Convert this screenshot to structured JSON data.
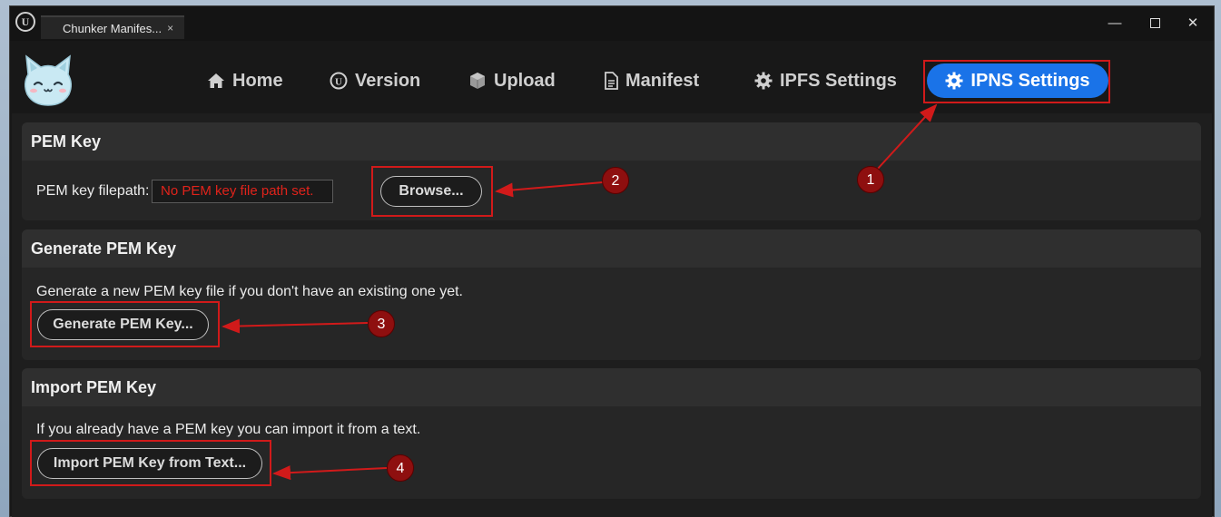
{
  "window": {
    "tab_title": "Chunker Manifes...",
    "tab_close": "×",
    "minimize": "—",
    "close": "✕"
  },
  "nav": {
    "items": [
      {
        "label": "Home",
        "icon": "home-icon"
      },
      {
        "label": "Version",
        "icon": "unreal-logo-icon"
      },
      {
        "label": "Upload",
        "icon": "cube-icon"
      },
      {
        "label": "Manifest",
        "icon": "document-icon"
      },
      {
        "label": "IPFS Settings",
        "icon": "gear-icon"
      },
      {
        "label": "IPNS Settings",
        "icon": "gear-icon",
        "active": true
      }
    ]
  },
  "sections": {
    "pem_key": {
      "title": "PEM Key",
      "filepath_label": "PEM key filepath:",
      "filepath_value": "No PEM key file path set.",
      "browse_label": "Browse..."
    },
    "generate": {
      "title": "Generate PEM Key",
      "description": "Generate a new PEM key file if you don't have an existing one yet.",
      "button_label": "Generate PEM Key..."
    },
    "import": {
      "title": "Import PEM Key",
      "description": "If you already have a PEM key you can import it from a text.",
      "button_label": "Import PEM Key from Text..."
    }
  },
  "annotations": {
    "markers": [
      "1",
      "2",
      "3",
      "4"
    ]
  },
  "colors": {
    "accent": "#1a73e8",
    "annotation_red": "#d11a1a",
    "marker_fill": "#8e0f0f",
    "error_text": "#e0231b"
  }
}
